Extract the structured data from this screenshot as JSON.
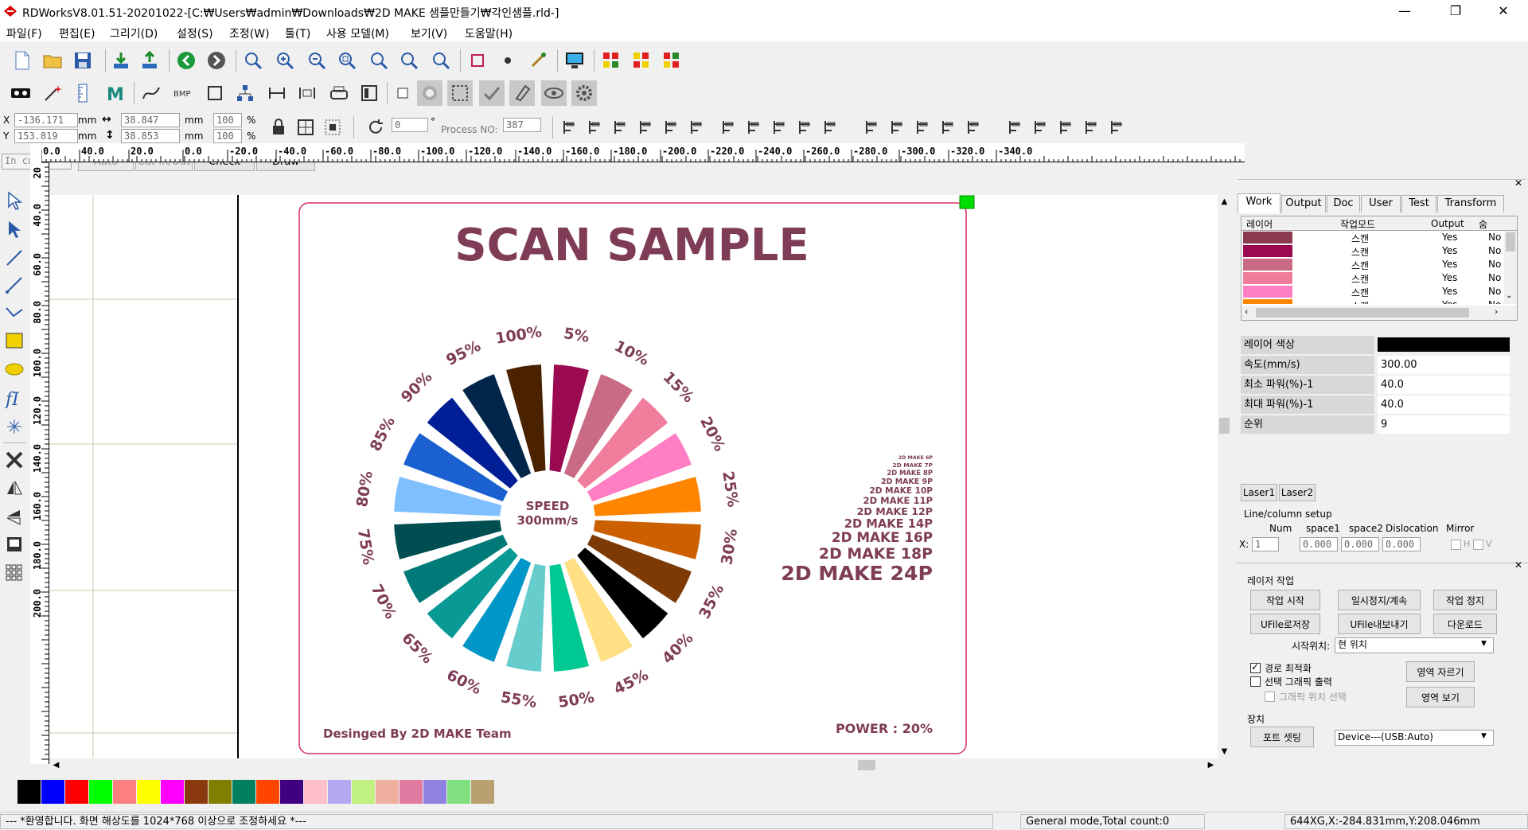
{
  "window": {
    "title": "RDWorksV8.01.51-20201022-[C:₩Users₩admin₩Downloads₩2D MAKE 샘플만들기₩각인샘플.rld-]",
    "min": "—",
    "max": "❐",
    "close": "✕"
  },
  "menu": [
    "파일(F)",
    "편집(E)",
    "그리기(D)",
    "설정(S)",
    "조정(W)",
    "툴(T)",
    "사용 모델(M)",
    "보기(V)",
    "도움말(H)"
  ],
  "coords": {
    "x_label": "X",
    "y_label": "Y",
    "x": "-136.171",
    "y": "153.819",
    "unit": "mm",
    "w": "38.847",
    "h": "38.853",
    "pct_w": "100",
    "pct_h": "100",
    "pct": "%",
    "angle": "0",
    "deg": "°",
    "process_label": "Process NO:",
    "process_no": "387"
  },
  "toolbar3": {
    "layer_select": "In cut",
    "auto": "Auto",
    "cut_inout": "Cut In/Out",
    "check": "Check",
    "draw": "Draw"
  },
  "hruler": [
    "0.0",
    "40.0",
    "20.0",
    "0.0",
    "-20.0",
    "-40.0",
    "-60.0",
    "-80.0",
    "-100.0",
    "-120.0",
    "-140.0",
    "-160.0",
    "-180.0",
    "-200.0",
    "-220.0",
    "-240.0",
    "-260.0",
    "-280.0",
    "-300.0",
    "-320.0",
    "-340.0"
  ],
  "vruler": [
    "20",
    "40.0",
    "60.0",
    "80.0",
    "100.0",
    "120.0",
    "140.0",
    "160.0",
    "180.0",
    "200.0"
  ],
  "sample": {
    "title": "SCAN SAMPLE",
    "speed_line1": "SPEED",
    "speed_line2": "300mm/s",
    "wheel": [
      {
        "label": "5%",
        "color": "#9b0a50"
      },
      {
        "label": "10%",
        "color": "#c96b85"
      },
      {
        "label": "15%",
        "color": "#f07d9b"
      },
      {
        "label": "20%",
        "color": "#ff7ec4"
      },
      {
        "label": "25%",
        "color": "#ff8400"
      },
      {
        "label": "30%",
        "color": "#cc6000"
      },
      {
        "label": "35%",
        "color": "#7d3a05"
      },
      {
        "label": "40%",
        "color": "#000000"
      },
      {
        "label": "45%",
        "color": "#ffe085"
      },
      {
        "label": "50%",
        "color": "#00c892"
      },
      {
        "label": "55%",
        "color": "#66cccc"
      },
      {
        "label": "60%",
        "color": "#0096c8"
      },
      {
        "label": "65%",
        "color": "#0a9a96"
      },
      {
        "label": "70%",
        "color": "#007a78"
      },
      {
        "label": "75%",
        "color": "#004e52"
      },
      {
        "label": "80%",
        "color": "#80bfff"
      },
      {
        "label": "85%",
        "color": "#1a60d0"
      },
      {
        "label": "90%",
        "color": "#001e96"
      },
      {
        "label": "95%",
        "color": "#02254a"
      },
      {
        "label": "100%",
        "color": "#4a2200"
      }
    ],
    "fonts": [
      "2D MAKE 6P",
      "2D MAKE 7P",
      "2D MAKE 8P",
      "2D MAKE 9P",
      "2D MAKE 10P",
      "2D MAKE 11P",
      "2D MAKE 12P",
      "2D MAKE 14P",
      "2D MAKE 16P",
      "2D MAKE 18P",
      "2D MAKE 24P"
    ],
    "power": "POWER : 20%",
    "designed": "Desinged By 2D MAKE Team"
  },
  "palette": [
    "#000000",
    "#0000ff",
    "#ff0000",
    "#00ff00",
    "#ff8080",
    "#ffff00",
    "#ff00ff",
    "#8b3a0f",
    "#808000",
    "#008060",
    "#ff4500",
    "#400080",
    "#ffc0cb",
    "#b4a8f0",
    "#c0f080",
    "#f0b0a0",
    "#e07aa0",
    "#9080e0",
    "#80e080",
    "#b8a070"
  ],
  "status": {
    "msg": "--- *환영합니다. 화면 해상도를 1024*768 이상으로 조정하세요 *---",
    "mode": "General mode,Total count:0",
    "pos": "644XG,X:-284.831mm,Y:208.046mm"
  },
  "panel": {
    "tabs": [
      "Work",
      "Output",
      "Doc",
      "User",
      "Test",
      "Transform"
    ],
    "layer_headers": [
      "레이어",
      "작업모드",
      "Output",
      "숨"
    ],
    "layers": [
      {
        "color": "#8b3a50",
        "mode": "스캔",
        "output": "Yes",
        "hide": "No"
      },
      {
        "color": "#9b0a50",
        "mode": "스캔",
        "output": "Yes",
        "hide": "No"
      },
      {
        "color": "#c96b85",
        "mode": "스캔",
        "output": "Yes",
        "hide": "No"
      },
      {
        "color": "#f07d9b",
        "mode": "스캔",
        "output": "Yes",
        "hide": "No"
      },
      {
        "color": "#ff7ec4",
        "mode": "스캔",
        "output": "Yes",
        "hide": "No"
      },
      {
        "color": "#ff8400",
        "mode": "스캔",
        "output": "Yes",
        "hide": "No"
      }
    ],
    "props": [
      {
        "key": "레이어 색상",
        "val": ""
      },
      {
        "key": "속도(mm/s)",
        "val": "300.00"
      },
      {
        "key": "최소 파워(%)-1",
        "val": "40.0"
      },
      {
        "key": "최대 파워(%)-1",
        "val": "40.0"
      },
      {
        "key": "순위",
        "val": "9"
      }
    ],
    "laser_tabs": [
      "Laser1",
      "Laser2"
    ],
    "linecol": {
      "title": "Line/column setup",
      "h_num": "Num",
      "h_space1": "space1",
      "h_space2": "space2",
      "h_disloc": "Dislocation",
      "h_mirror": "Mirror",
      "x_label": "X:",
      "num": "1",
      "space1": "0.000",
      "space2": "0.000",
      "disloc": "0.000",
      "mh": "H",
      "mv": "V"
    },
    "work": {
      "title": "레이저 작업",
      "start": "작업 시작",
      "pause": "일시정지/계속",
      "stop": "작업 정지",
      "save_ufile": "UFile로저장",
      "export_ufile": "UFile내보내기",
      "download": "다운로드",
      "start_pos_label": "시작위치:",
      "start_pos": "현 위치",
      "opt_path": "경로 최적화",
      "sel_output": "선택 그래픽 출력",
      "graph_pos": "그래픽 위치 선택",
      "cut_area": "영역 자르기",
      "view_area": "영역 보기"
    },
    "device": {
      "title": "장치",
      "port": "포트 셋팅",
      "device": "Device---(USB:Auto)"
    }
  }
}
